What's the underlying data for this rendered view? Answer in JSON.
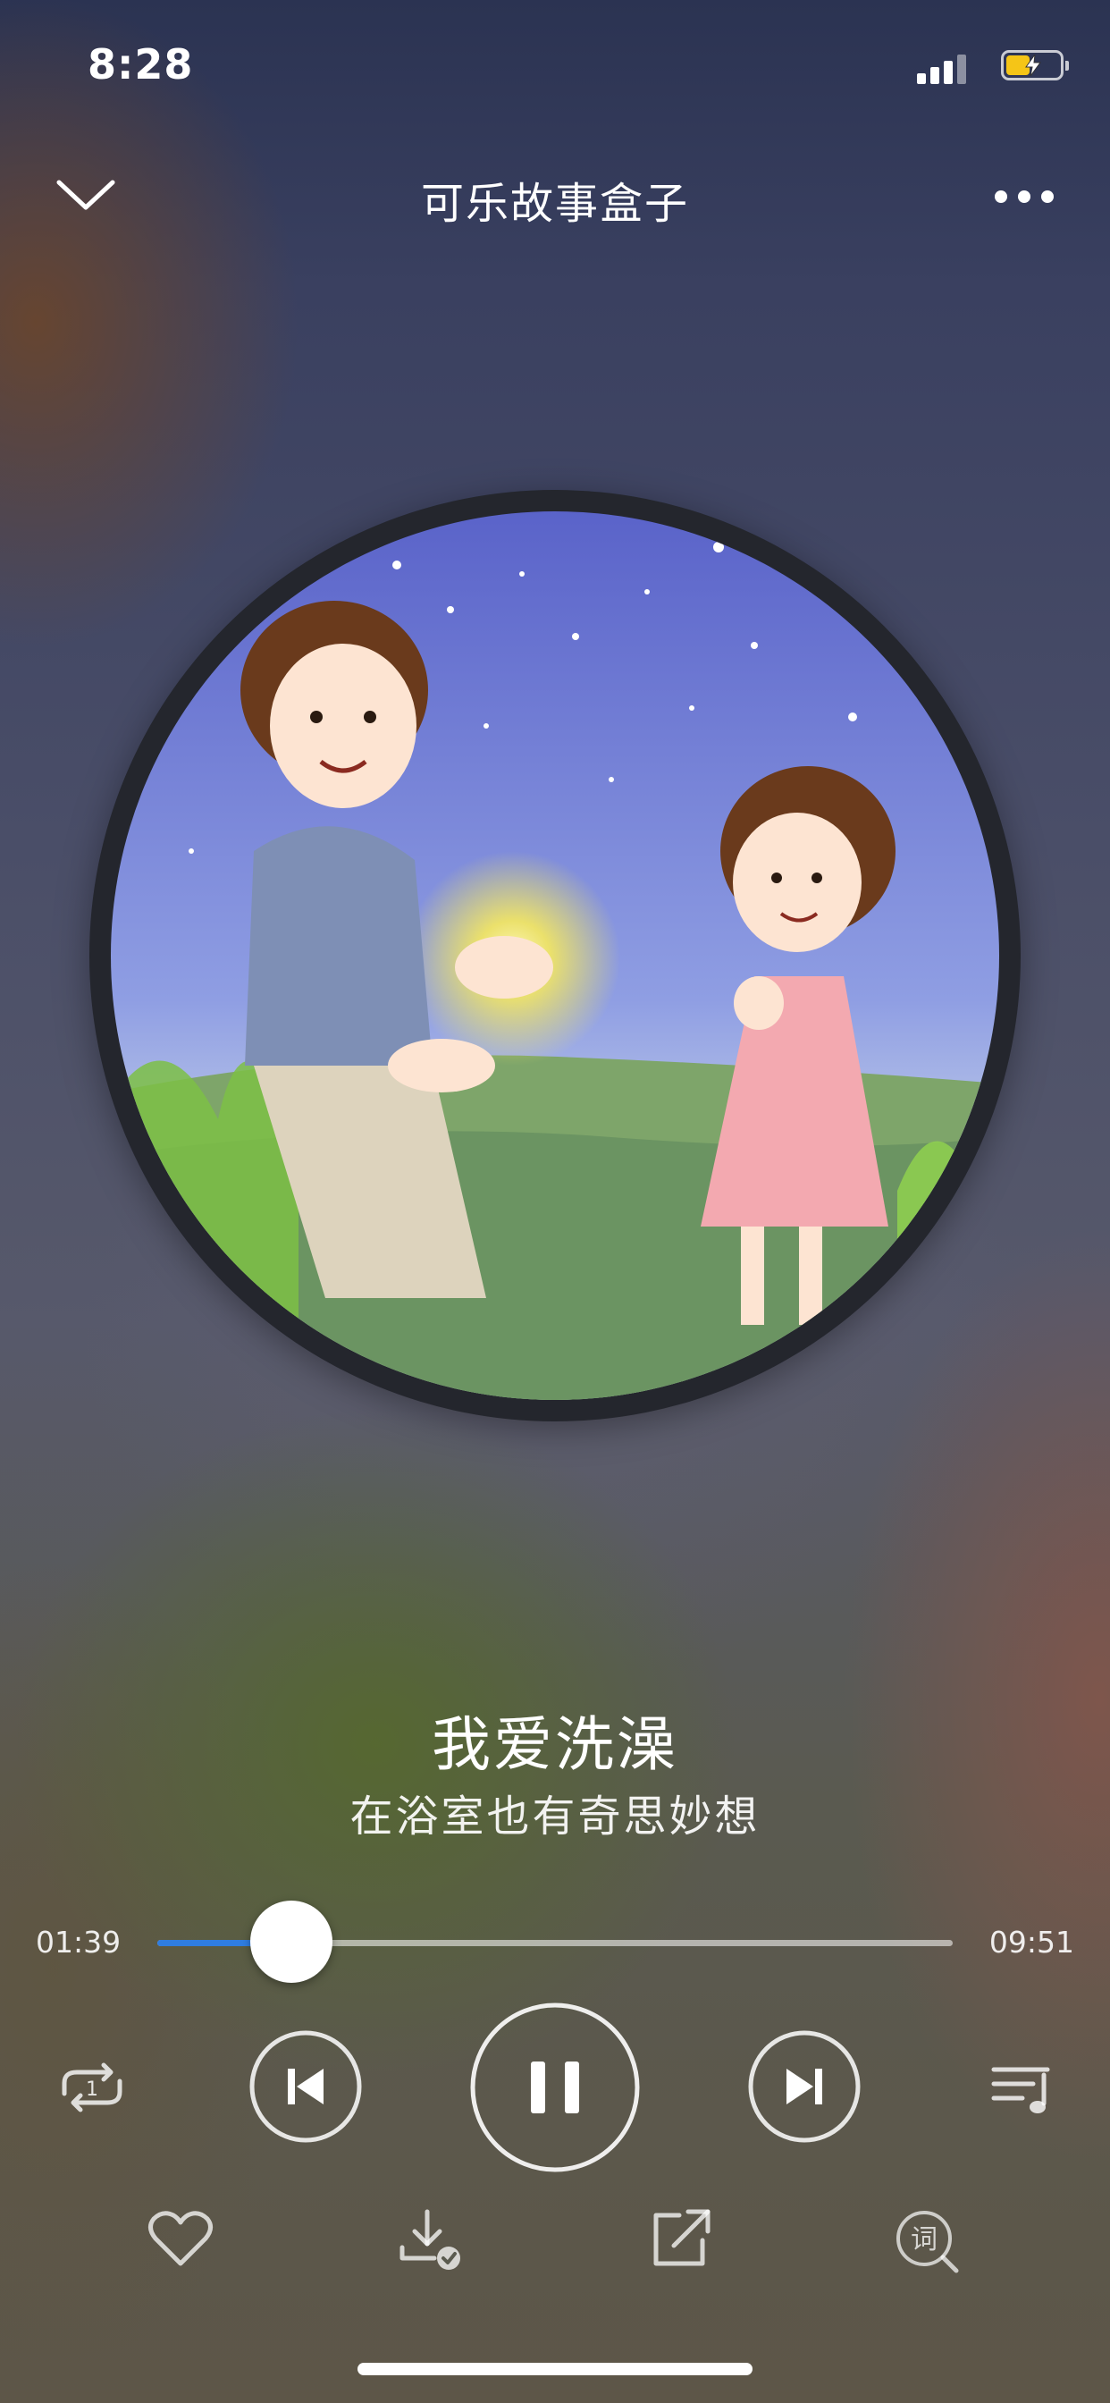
{
  "status": {
    "time": "8:28",
    "battery_level": 0.45,
    "battery_color": "#f5c517"
  },
  "header": {
    "title": "可乐故事盒子",
    "back_icon": "chevron-down-icon",
    "more_icon": "more-dots-icon"
  },
  "track": {
    "title": "我爱洗澡",
    "subtitle": "在浴室也有奇思妙想"
  },
  "progress": {
    "current": "01:39",
    "total": "09:51",
    "fraction": 0.168,
    "accent": "#2f7de1"
  },
  "controls": {
    "repeat_badge": "1",
    "play_state": "playing"
  },
  "actions": {
    "lyrics_glyph": "词"
  }
}
